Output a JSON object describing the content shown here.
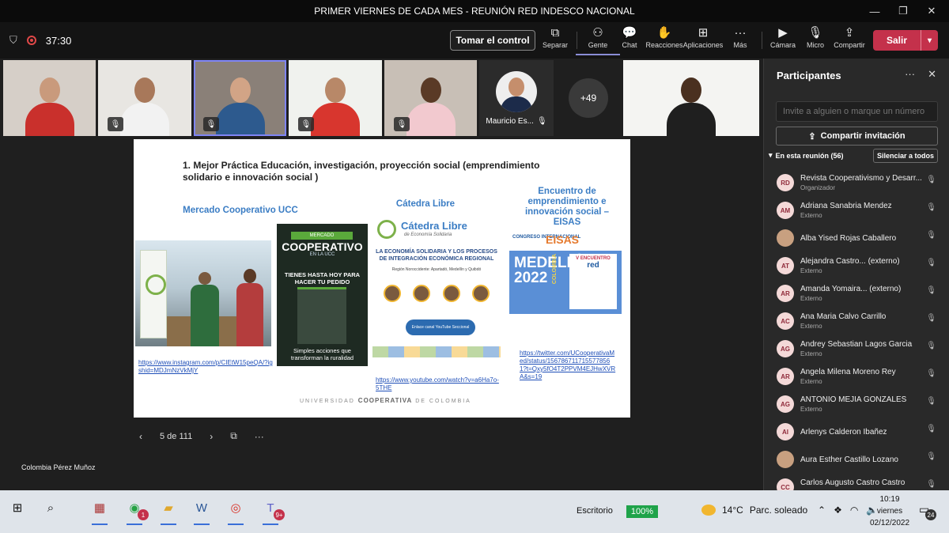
{
  "window": {
    "title": "PRIMER VIERNES DE CADA MES - REUNIÓN RED INDESCO NACIONAL"
  },
  "toolbar": {
    "timer": "37:30",
    "take_control": "Tomar el control",
    "items": [
      {
        "label": "Separar",
        "icon": "popout-icon"
      },
      {
        "label": "Gente",
        "icon": "people-icon"
      },
      {
        "label": "Chat",
        "icon": "chat-icon"
      },
      {
        "label": "Reacciones",
        "icon": "hand-icon"
      },
      {
        "label": "Aplicaciones",
        "icon": "apps-icon"
      },
      {
        "label": "Más",
        "icon": "more-icon"
      },
      {
        "label": "Cámara",
        "icon": "camera-icon"
      },
      {
        "label": "Micro",
        "icon": "mic-off-icon"
      },
      {
        "label": "Compartir",
        "icon": "share-icon"
      }
    ],
    "leave": "Salir"
  },
  "video": {
    "avatar_name": "Mauricio Es...",
    "more_count": "+49"
  },
  "slide": {
    "title": "1.  Mejor Práctica Educación, investigación, proyección social (emprendimiento solidario e innovación social )",
    "col1_head": "Mercado Cooperativo UCC",
    "col2_head": "Cátedra Libre",
    "col3_head": "Encuentro de emprendimiento e innovación social – EISAS",
    "link1": "https://www.instagram.com/p/CIEtW15peQA/?igshid=MDJmNzVkMjY",
    "link2": "https://www.youtube.com/watch?v=a6Ha7o-5THE",
    "link3": "https://twitter.com/UCooperativaMed/status/1567867117155778561?t=Qxy5fO4T2PPVM4EJHwXVRA&s=19",
    "poster1": {
      "tag": "MERCADO",
      "title": "COOPERATIVO",
      "sub": "EN LA UCC",
      "headline": "TIENES HASTA HOY PARA HACER TU PEDIDO",
      "foot": "Simples acciones que transforman la ruralidad"
    },
    "poster2": {
      "title": "Cátedra Libre",
      "sub": "de Economía Solidaria",
      "headline": "LA ECONOMÍA SOLIDARIA Y LOS PROCESOS DE INTEGRACIÓN ECONÓMICA REGIONAL",
      "info": "Región Noroccidente: Apartadó, Medellín y Quibdó",
      "button": "Enlace canal YouTube Seccional Medellín UCC"
    },
    "poster3": {
      "congreso": "CONGRESO INTERNACIONAL",
      "brand": "EISAS",
      "city": "MEDELLÍN 2022",
      "country": "COLOMBIA",
      "box_title": "V ENCUENTRO",
      "box_brand": "red"
    },
    "footer_prefix": "UNIVERSIDAD",
    "footer_brand": "COOPERATIVA",
    "footer_suffix": "DE COLOMBIA"
  },
  "slide_nav": {
    "page": "5 de 111"
  },
  "presenter": "Colombia Pérez Muñoz",
  "participants": {
    "title": "Participantes",
    "invite_placeholder": "Invite a alguien o marque un número",
    "share_invite": "Compartir invitación",
    "in_meeting": "En esta reunión (56)",
    "mute_all": "Silenciar a todos",
    "list": [
      {
        "initials": "RD",
        "name": "Revista Cooperativismo y Desarr...",
        "role": "Organizador"
      },
      {
        "initials": "AM",
        "name": "Adriana Sanabria Mendez",
        "role": "Externo"
      },
      {
        "initials": "",
        "name": "Alba Yised Rojas Caballero",
        "role": ""
      },
      {
        "initials": "AT",
        "name": "Alejandra Castro... (externo)",
        "role": "Externo"
      },
      {
        "initials": "AR",
        "name": "Amanda Yomaira... (externo)",
        "role": "Externo"
      },
      {
        "initials": "AC",
        "name": "Ana Maria Calvo Carrillo",
        "role": "Externo"
      },
      {
        "initials": "AG",
        "name": "Andrey Sebastian Lagos Garcia",
        "role": "Externo"
      },
      {
        "initials": "AR",
        "name": "Angela Milena Moreno Rey",
        "role": "Externo"
      },
      {
        "initials": "AG",
        "name": "ANTONIO MEJIA GONZALES",
        "role": "Externo"
      },
      {
        "initials": "AI",
        "name": "Arlenys Calderon Ibañez",
        "role": ""
      },
      {
        "initials": "",
        "name": "Aura Esther Castillo Lozano",
        "role": ""
      },
      {
        "initials": "CC",
        "name": "Carlos Augusto Castro Castro",
        "role": ""
      }
    ]
  },
  "taskbar": {
    "desktop": "Escritorio",
    "zoom": "100%",
    "temp": "14°C",
    "weather": "Parc. soleado",
    "time": "10:19",
    "day": "viernes",
    "date": "02/12/2022",
    "notifications": "24",
    "whatsapp_badge": "1",
    "teams_badge": "9+"
  }
}
